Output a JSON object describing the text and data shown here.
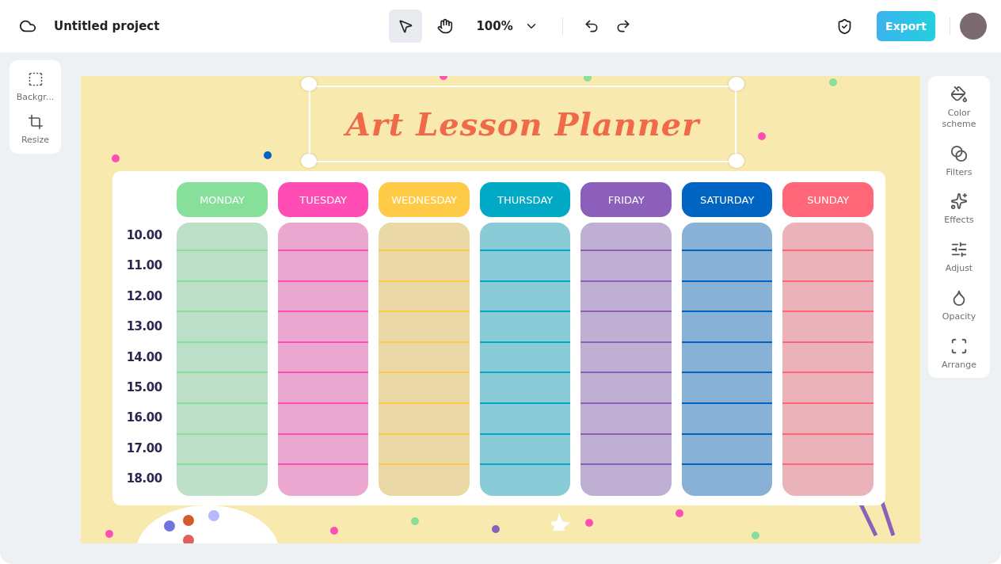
{
  "header": {
    "project_title": "Untitled project",
    "tools": [
      {
        "kind": "pointer",
        "selected": true
      },
      {
        "kind": "hand",
        "selected": false
      }
    ],
    "zoom": "100%",
    "export": "Export"
  },
  "left_panel": [
    {
      "kind": "background",
      "label": "Backgr..."
    },
    {
      "kind": "resize",
      "label": "Resize"
    }
  ],
  "right_panel": [
    {
      "kind": "color",
      "label": "Color scheme"
    },
    {
      "kind": "filters",
      "label": "Filters"
    },
    {
      "kind": "effects",
      "label": "Effects"
    },
    {
      "kind": "adjust",
      "label": "Adjust"
    },
    {
      "kind": "opacity",
      "label": "Opacity"
    },
    {
      "kind": "arrange",
      "label": "Arrange"
    }
  ],
  "planner": {
    "title": "Art Lesson Planner",
    "times": [
      "10.00",
      "11.00",
      "12.00",
      "13.00",
      "14.00",
      "15.00",
      "16.00",
      "17.00",
      "18.00"
    ],
    "days": [
      {
        "label": "MONDAY",
        "color": "#86e09a"
      },
      {
        "label": "TUESDAY",
        "color": "#ff4db5"
      },
      {
        "label": "WEDNESDAY",
        "color": "#ffcb47"
      },
      {
        "label": "THURSDAY",
        "color": "#00a9c6"
      },
      {
        "label": "FRIDAY",
        "color": "#8c5fba"
      },
      {
        "label": "SATURDAY",
        "color": "#0064c2"
      },
      {
        "label": "SUNDAY",
        "color": "#ff6677"
      }
    ]
  }
}
